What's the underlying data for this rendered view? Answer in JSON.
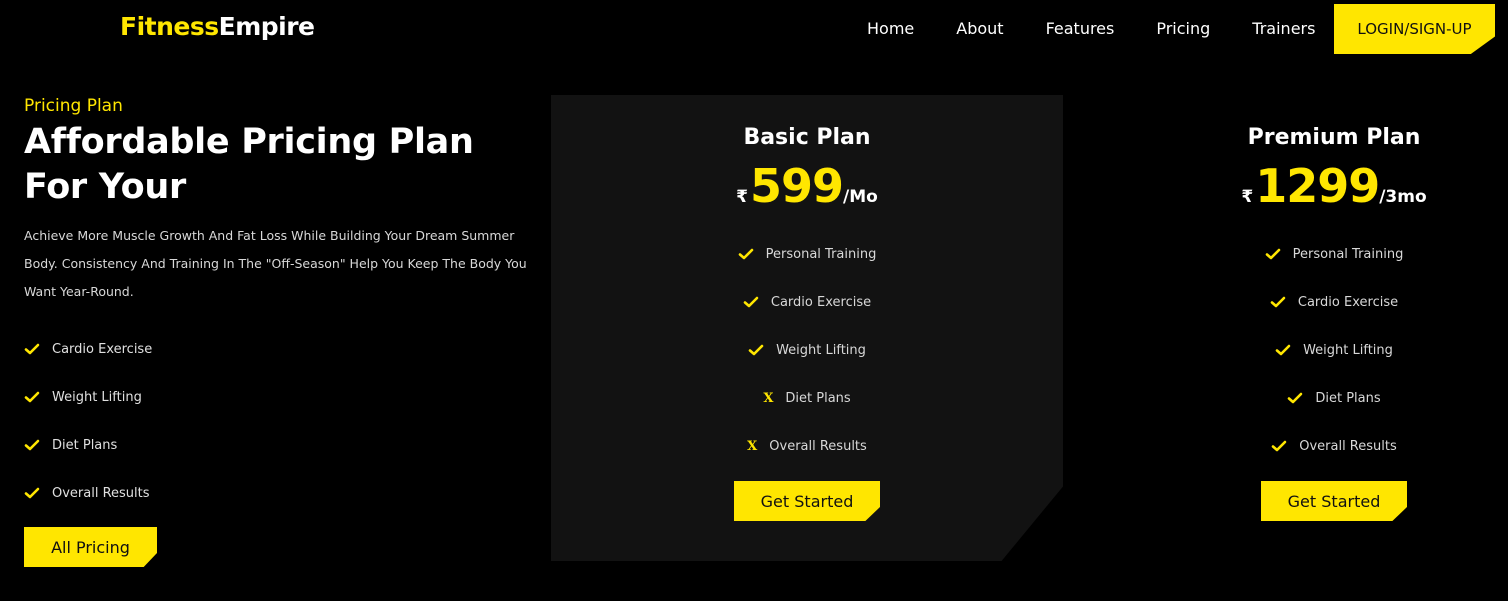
{
  "header": {
    "logo_part1": "Fitness",
    "logo_part2": "Empire",
    "nav": [
      "Home",
      "About",
      "Features",
      "Pricing",
      "Trainers"
    ],
    "login_label": "LOGIN/SIGN-UP"
  },
  "intro": {
    "eyebrow": "Pricing Plan",
    "title": "Affordable Pricing Plan For Your",
    "description": "Achieve More Muscle Growth And Fat Loss While Building Your Dream Summer Body. Consistency And Training In The \"Off-Season\" Help You Keep The Body You Want Year-Round.",
    "features": [
      "Cardio Exercise",
      "Weight Lifting",
      "Diet Plans",
      "Overall Results"
    ],
    "button_label": "All Pricing"
  },
  "plans": [
    {
      "name": "Basic Plan",
      "currency": "₹",
      "price": "599",
      "period": "/Mo",
      "features": [
        {
          "label": "Personal Training",
          "included": true
        },
        {
          "label": "Cardio Exercise",
          "included": true
        },
        {
          "label": "Weight Lifting",
          "included": true
        },
        {
          "label": "Diet Plans",
          "included": false
        },
        {
          "label": "Overall Results",
          "included": false
        }
      ],
      "button_label": "Get Started"
    },
    {
      "name": "Premium Plan",
      "currency": "₹",
      "price": "1299",
      "period": "/3mo",
      "features": [
        {
          "label": "Personal Training",
          "included": true
        },
        {
          "label": "Cardio Exercise",
          "included": true
        },
        {
          "label": "Weight Lifting",
          "included": true
        },
        {
          "label": "Diet Plans",
          "included": true
        },
        {
          "label": "Overall Results",
          "included": true
        }
      ],
      "button_label": "Get Started"
    }
  ],
  "icons": {
    "included": "check-icon",
    "excluded": "x-icon",
    "excluded_glyph": "X"
  },
  "colors": {
    "accent": "#ffe600",
    "background": "#000000",
    "card": "#121212"
  }
}
